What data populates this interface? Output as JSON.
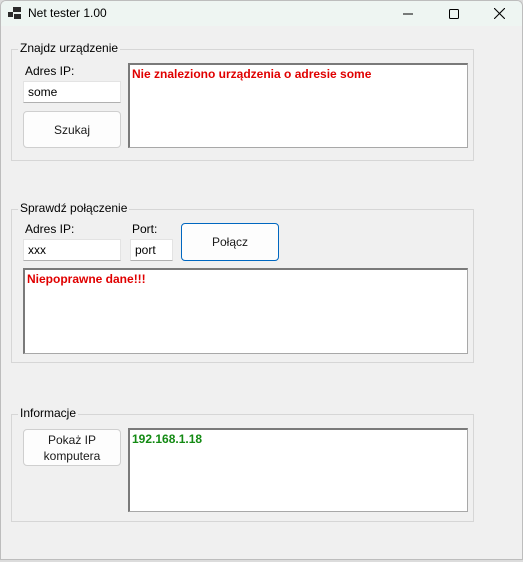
{
  "window": {
    "title": "Net tester 1.00"
  },
  "find_device": {
    "legend": "Znajdz urządzenie",
    "ip_label": "Adres IP:",
    "ip_value": "some",
    "search_button": "Szukaj",
    "output_text": "Nie znaleziono urządzenia o adresie some"
  },
  "check_connection": {
    "legend": "Sprawdź połączenie",
    "ip_label": "Adres IP:",
    "ip_value": "xxx",
    "port_label": "Port:",
    "port_value": "port",
    "connect_button": "Połącz",
    "output_text": "Niepoprawne dane!!!"
  },
  "info": {
    "legend": "Informacje",
    "show_ip_button": "Pokaż IP komputera",
    "output_text": "192.168.1.18"
  },
  "colors": {
    "error_text": "#e00000",
    "success_text": "#138a13",
    "focus_border": "#0067c0"
  }
}
